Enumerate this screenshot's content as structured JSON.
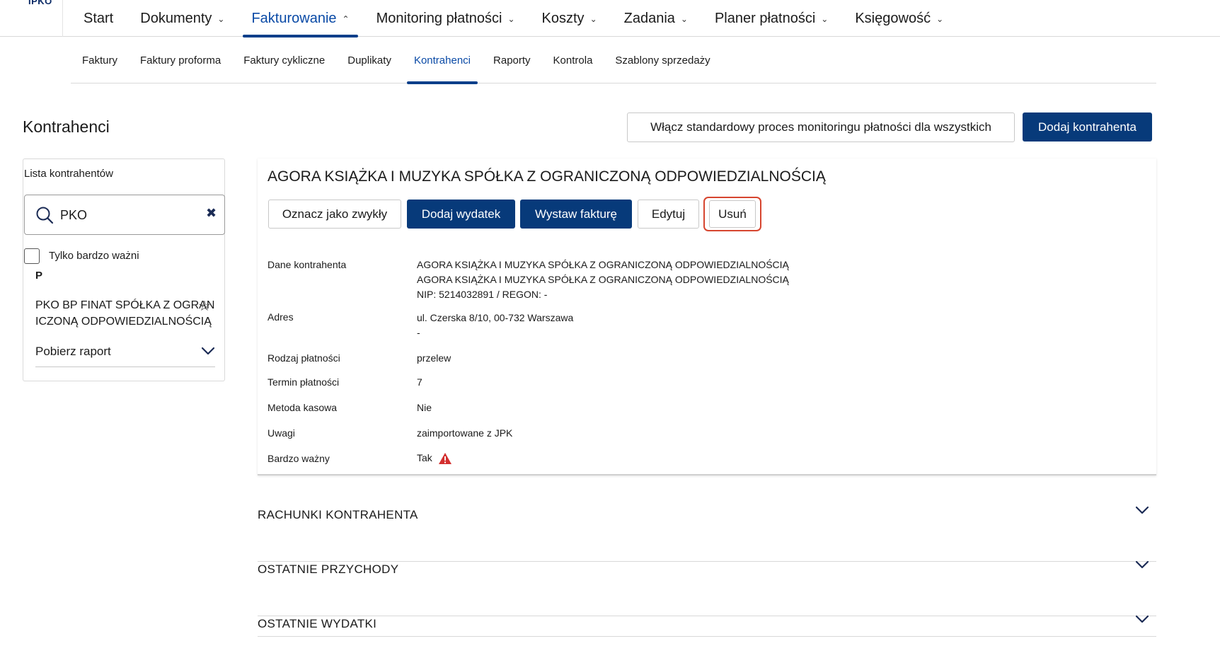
{
  "logo": {
    "text": "IPKO"
  },
  "topnav": {
    "items": [
      {
        "label": "Start",
        "has_menu": false
      },
      {
        "label": "Dokumenty",
        "has_menu": true
      },
      {
        "label": "Fakturowanie",
        "has_menu": true,
        "active": true
      },
      {
        "label": "Monitoring płatności",
        "has_menu": true
      },
      {
        "label": "Koszty",
        "has_menu": true
      },
      {
        "label": "Zadania",
        "has_menu": true
      },
      {
        "label": "Planer płatności",
        "has_menu": true
      },
      {
        "label": "Księgowość",
        "has_menu": true
      }
    ]
  },
  "subnav": {
    "items": [
      {
        "label": "Faktury"
      },
      {
        "label": "Faktury proforma"
      },
      {
        "label": "Faktury cykliczne"
      },
      {
        "label": "Duplikaty"
      },
      {
        "label": "Kontrahenci",
        "active": true
      },
      {
        "label": "Raporty"
      },
      {
        "label": "Kontrola"
      },
      {
        "label": "Szablony sprzedaży"
      }
    ]
  },
  "header": {
    "title": "Kontrahenci",
    "monitoring_button": "Włącz standardowy proces monitoringu płatności dla wszystkich",
    "add_button": "Dodaj kontrahenta"
  },
  "sidebar": {
    "title": "Lista kontrahentów",
    "search_value": "PKO",
    "only_important_label": "Tylko bardzo ważni",
    "only_important_checked": false,
    "group_letter": "P",
    "contractor_name": "PKO BP FINAT SPÓŁKA Z OGRAN ICZONĄ ODPOWIEDZIALNOŚCIĄ",
    "report_label": "Pobierz raport"
  },
  "details": {
    "title": "AGORA KSIĄŻKA I MUZYKA SPÓŁKA Z OGRANICZONĄ ODPOWIEDZIALNOŚCIĄ",
    "buttons": {
      "mark": "Oznacz jako zwykły",
      "add_expense": "Dodaj wydatek",
      "invoice": "Wystaw fakturę",
      "edit": "Edytuj",
      "delete": "Usuń"
    },
    "labels": {
      "data": "Dane kontrahenta",
      "address": "Adres",
      "payment_type": "Rodzaj płatności",
      "payment_term": "Termin płatności",
      "cash_method": "Metoda kasowa",
      "notes": "Uwagi",
      "very_important": "Bardzo ważny"
    },
    "values": {
      "name_line1": "AGORA KSIĄŻKA I MUZYKA SPÓŁKA Z OGRANICZONĄ ODPOWIEDZIALNOŚCIĄ",
      "name_line2": "AGORA KSIĄŻKA I MUZYKA SPÓŁKA Z OGRANICZONĄ ODPOWIEDZIALNOŚCIĄ",
      "nip_regon": "NIP: 5214032891 / REGON: -",
      "address_line1": "ul. Czerska 8/10, 00-732 Warszawa",
      "address_line2": "-",
      "payment_type": "przelew",
      "payment_term": "7",
      "cash_method": "Nie",
      "notes": "zaimportowane z JPK",
      "very_important": "Tak"
    }
  },
  "accordions": [
    {
      "title": "RACHUNKI KONTRAHENTA"
    },
    {
      "title": "OSTATNIE PRZYCHODY"
    },
    {
      "title": "OSTATNIE WYDATKI"
    }
  ],
  "colors": {
    "primary": "#073a7a",
    "active_link": "#0a4aa6",
    "highlight_border": "#d6452f",
    "warning": "#d32f2f"
  }
}
